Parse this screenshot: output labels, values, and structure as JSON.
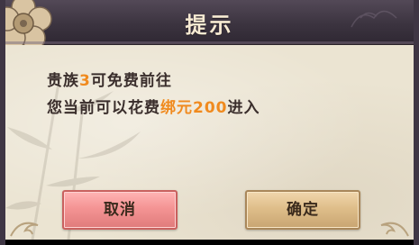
{
  "dialog": {
    "title": "提示",
    "line1": {
      "prefix": "贵族",
      "highlight": "3",
      "suffix": "可免费前往"
    },
    "line2": {
      "prefix": "您当前可以花费",
      "highlight": "绑元200",
      "suffix": "进入"
    },
    "highlight_color": "#f08a1e"
  },
  "buttons": {
    "cancel_label": "取消",
    "confirm_label": "确定"
  },
  "icons": {
    "header_left": "plum-blossom-icon",
    "background": "bamboo-icon"
  },
  "colors": {
    "header": "#3c3440",
    "title": "#f6ead2",
    "panel": "#ebe4d2",
    "text": "#3a2e2c",
    "cancel": "#f49494",
    "confirm": "#dfbe8a"
  }
}
